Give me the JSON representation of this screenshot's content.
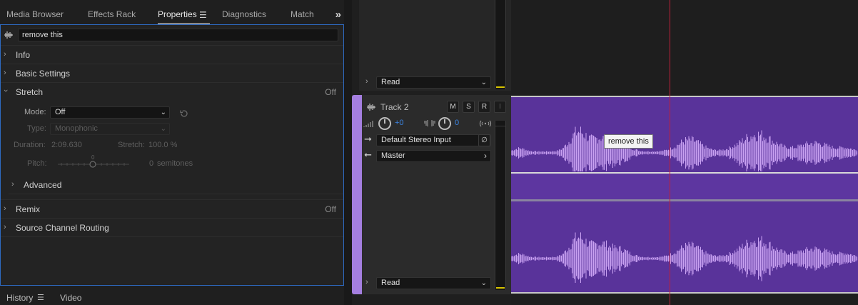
{
  "panel_tabs": [
    {
      "label": "Media Browser"
    },
    {
      "label": "Effects Rack"
    },
    {
      "label": "Properties",
      "active": true
    },
    {
      "label": "Diagnostics"
    },
    {
      "label": "Match L"
    }
  ],
  "search": {
    "value": "remove this"
  },
  "sections": {
    "info": {
      "label": "Info"
    },
    "basic": {
      "label": "Basic Settings"
    },
    "stretch": {
      "label": "Stretch",
      "state": "Off"
    },
    "remix": {
      "label": "Remix",
      "state": "Off"
    },
    "routing": {
      "label": "Source Channel Routing"
    }
  },
  "stretch": {
    "mode_label": "Mode:",
    "mode_value": "Off",
    "type_label": "Type:",
    "type_value": "Monophonic",
    "duration_label": "Duration:",
    "duration_value": "2:09.630",
    "stretch_label": "Stretch:",
    "stretch_value": "100.0 %",
    "pitch_label": "Pitch:",
    "pitch_zero": "0",
    "pitch_value": "0",
    "pitch_unit": "semitones",
    "advanced_label": "Advanced"
  },
  "bottom_tabs": [
    {
      "label": "History"
    },
    {
      "label": "Video"
    }
  ],
  "track1": {
    "automation": "Read"
  },
  "track2": {
    "name": "Track 2",
    "buttons": {
      "mute": "M",
      "solo": "S",
      "record": "R",
      "input": "I"
    },
    "volume_value": "+0",
    "pan_value": "0",
    "input": "Default Stereo Input",
    "output": "Master",
    "automation": "Read"
  },
  "tooltip": {
    "text": "remove this"
  },
  "colors": {
    "accent": "#2e6ac2",
    "track_color": "#a57fe0",
    "clip_fill": "#59339a",
    "waveform": "#c9a2f2",
    "playhead": "#c0203a"
  }
}
